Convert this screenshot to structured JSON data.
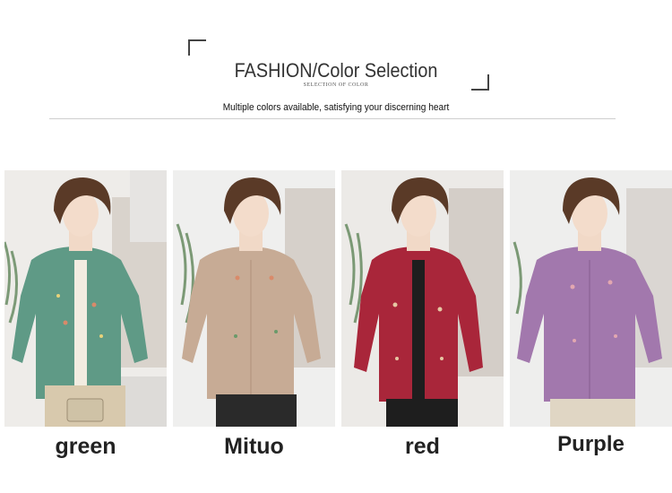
{
  "header": {
    "title": "FASHION/Color Selection",
    "subtitle": "SELECTION OF COLOR",
    "tagline": "Multiple colors available, satisfying your discerning heart"
  },
  "options": [
    {
      "label": "green",
      "color": "#5f9a86"
    },
    {
      "label": "Mituo",
      "color": "#c7ab95"
    },
    {
      "label": "red",
      "color": "#a9263a"
    },
    {
      "label": "Purple",
      "color": "#a278ad"
    }
  ]
}
